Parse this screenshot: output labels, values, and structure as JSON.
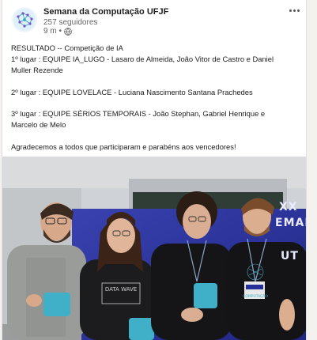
{
  "post": {
    "author": "Semana da Computação UFJF",
    "followers": "257 seguidores",
    "time": "9 m •",
    "text": {
      "line1": "RESULTADO -- Competição de IA",
      "line2": "1º lugar : EQUIPE IA_LUGO - Lasaro de Almeida, João Vitor de Castro e Daniel",
      "line3": "Muller Rezende",
      "line4": "2º lugar : EQUIPE LOVELACE - Luciana Nascimento Santana Prachedes",
      "line5": "3º lugar : EQUIPE SÉRIOS TEMPORAIS - João Stephan, Gabriel Henrique e",
      "line6": "Marcelo de Melo",
      "line7": "Agradecemos a todos que participaram e parabéns aos vencedores!"
    }
  },
  "photo": {
    "banner_line1": "XX",
    "banner_line2": "EMANA",
    "banner_line3": "UT",
    "shirt_text": "DATA WAVE",
    "badge_text": "COMPUTAÇÃO"
  },
  "icons": {
    "avatar": "brain-network-logo",
    "visibility": "globe-icon",
    "menu": "more-options-icon"
  },
  "colors": {
    "background": "#f4f2ee",
    "card": "#ffffff",
    "muted_text": "#666666",
    "banner_blue": "#27309a"
  }
}
